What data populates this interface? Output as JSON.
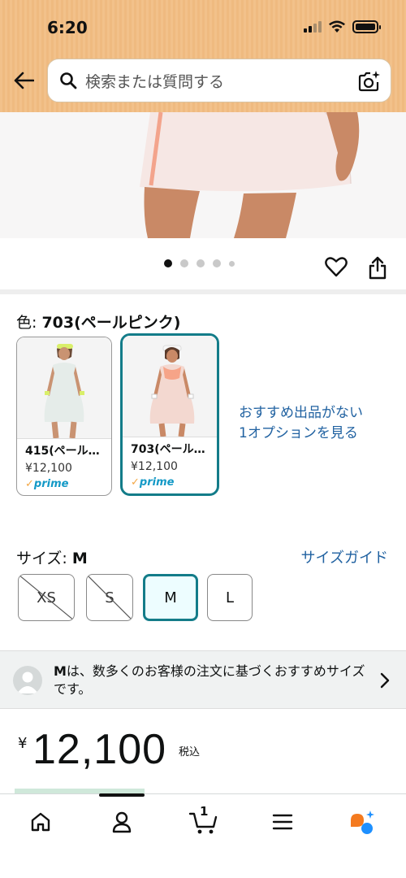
{
  "status_bar": {
    "time": "6:20"
  },
  "search": {
    "placeholder": "検索または質問する"
  },
  "color": {
    "label_prefix": "色: ",
    "selected_value": "703(ペールピンク)",
    "options": [
      {
        "name": "415(ペール…",
        "price": "¥12,100",
        "prime": "prime"
      },
      {
        "name": "703(ペール…",
        "price": "¥12,100",
        "prime": "prime"
      }
    ],
    "more_link_line1": "おすすめ出品がない",
    "more_link_line2": "1オプションを見る"
  },
  "size": {
    "label_prefix": "サイズ: ",
    "selected_value": "M",
    "guide_label": "サイズガイド",
    "options": [
      {
        "label": "XS",
        "available": false
      },
      {
        "label": "S",
        "available": false
      },
      {
        "label": "M",
        "available": true
      },
      {
        "label": "L",
        "available": true
      }
    ]
  },
  "recommendation": {
    "bold": "M",
    "text": "は、数多くのお客様の注文に基づくおすすめサイズです。"
  },
  "price": {
    "currency": "¥",
    "amount": "12,100",
    "tax": "税込"
  },
  "bottom_nav": {
    "cart_count": "1"
  },
  "colors": {
    "accent": "#137c89",
    "link": "#2162a1",
    "header": "#f2c18a",
    "prime": "#1399c6"
  }
}
